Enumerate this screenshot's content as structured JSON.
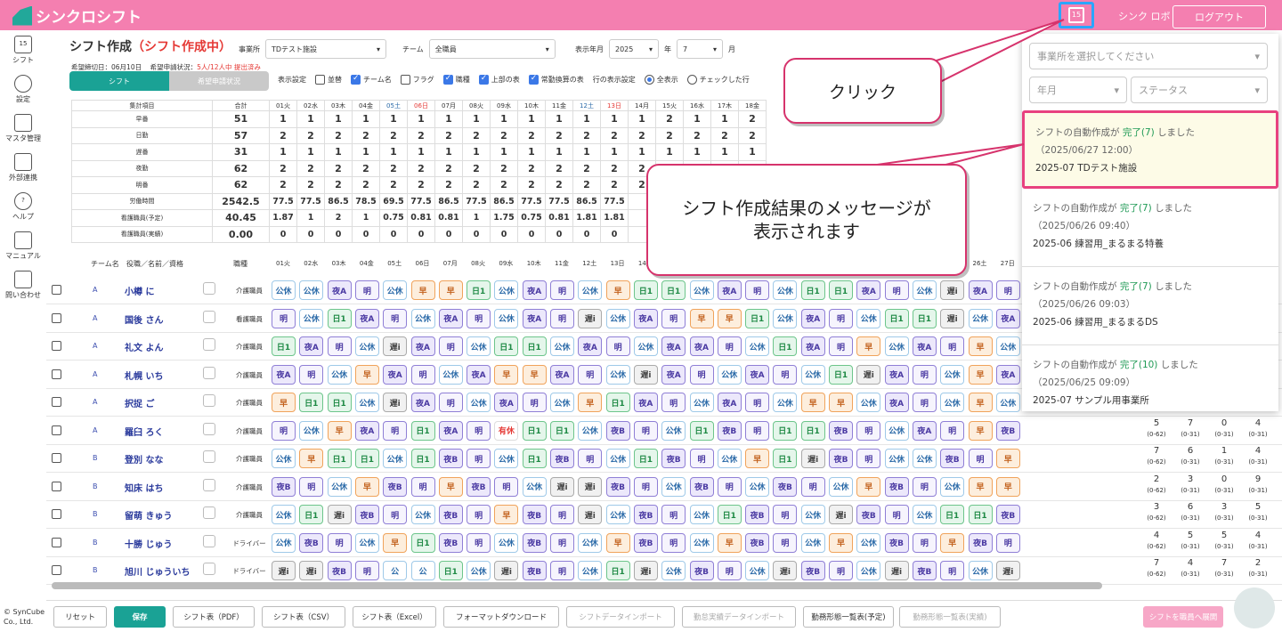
{
  "app": {
    "logo": "シンクロシフト",
    "sync_user": "シンク ロボ",
    "logout": "ログアウト",
    "calendar_day": "15"
  },
  "sidebar": [
    {
      "label": "シフト",
      "icon": "calendar-icon"
    },
    {
      "label": "設定",
      "icon": "gear-icon"
    },
    {
      "label": "マスタ管理",
      "icon": "database-icon"
    },
    {
      "label": "外部連携",
      "icon": "cloud-icon"
    },
    {
      "label": "ヘルプ",
      "icon": "help-icon"
    },
    {
      "label": "マニュアル",
      "icon": "manual-icon"
    },
    {
      "label": "問い合わせ",
      "icon": "mail-icon"
    }
  ],
  "copyright": "© SynCube Co., Ltd.",
  "header": {
    "title": "シフト作成",
    "status": "（シフト作成中）",
    "office_label": "事業所",
    "office": "TDテスト施設",
    "team_label": "チーム",
    "team": "全職員",
    "ym_label": "表示年月",
    "year": "2025",
    "year_unit": "年",
    "month": "7",
    "month_unit": "月",
    "deadline": "希望締切日：06月10日",
    "request_label": "希望申請状況：",
    "request_status": "5人/12人中 提出済み"
  },
  "tabs": {
    "shift": "シフト",
    "request": "希望申請状況"
  },
  "options": {
    "label": "表示設定",
    "items": [
      {
        "t": "並替",
        "on": false
      },
      {
        "t": "チーム名",
        "on": true
      },
      {
        "t": "フラグ",
        "on": false
      },
      {
        "t": "職種",
        "on": true
      },
      {
        "t": "上部の表",
        "on": true
      },
      {
        "t": "常勤換算の表",
        "on": true
      }
    ],
    "row_label": "行の表示設定",
    "all": "全表示",
    "checked": "チェックした行"
  },
  "summary": {
    "head": "集計項目",
    "total": "合計",
    "days": [
      "01火",
      "02水",
      "03木",
      "04金",
      "05土",
      "06日",
      "07月",
      "08火",
      "09水",
      "10木",
      "11金",
      "12土",
      "13日",
      "14月",
      "15火",
      "16水",
      "17木",
      "18金"
    ],
    "rows": [
      {
        "l": "早番",
        "t": "51",
        "v": [
          "1",
          "1",
          "1",
          "1",
          "1",
          "1",
          "1",
          "1",
          "1",
          "1",
          "1",
          "1",
          "1",
          "1",
          "2",
          "1",
          "1",
          "2"
        ]
      },
      {
        "l": "日勤",
        "t": "57",
        "v": [
          "2",
          "2",
          "2",
          "2",
          "2",
          "2",
          "2",
          "2",
          "2",
          "2",
          "2",
          "2",
          "2",
          "2",
          "2",
          "2",
          "2",
          "2"
        ]
      },
      {
        "l": "遅番",
        "t": "31",
        "v": [
          "1",
          "1",
          "1",
          "1",
          "1",
          "1",
          "1",
          "1",
          "1",
          "1",
          "1",
          "1",
          "1",
          "1",
          "1",
          "1",
          "1",
          "1"
        ]
      },
      {
        "l": "夜勤",
        "t": "62",
        "v": [
          "2",
          "2",
          "2",
          "2",
          "2",
          "2",
          "2",
          "2",
          "2",
          "2",
          "2",
          "2",
          "2",
          "2",
          "2",
          "2",
          "2",
          "2"
        ]
      },
      {
        "l": "明番",
        "t": "62",
        "v": [
          "2",
          "2",
          "2",
          "2",
          "2",
          "2",
          "2",
          "2",
          "2",
          "2",
          "2",
          "2",
          "2",
          "2",
          "2",
          "2",
          "2",
          "2"
        ]
      },
      {
        "l": "労働時間",
        "t": "2542.5",
        "v": [
          "77.5",
          "77.5",
          "86.5",
          "78.5",
          "69.5",
          "77.5",
          "86.5",
          "77.5",
          "86.5",
          "77.5",
          "77.5",
          "86.5",
          "77.5",
          "",
          "",
          "",
          "",
          ""
        ]
      },
      {
        "l": "看護職員(予定)",
        "t": "40.45",
        "v": [
          "1.87",
          "1",
          "2",
          "1",
          "0.75",
          "0.81",
          "0.81",
          "1",
          "1.75",
          "0.75",
          "0.81",
          "1.81",
          "1.81",
          "",
          "",
          "",
          "",
          ""
        ]
      },
      {
        "l": "看護職員(実績)",
        "t": "0.00",
        "v": [
          "0",
          "0",
          "0",
          "0",
          "0",
          "0",
          "0",
          "0",
          "0",
          "0",
          "0",
          "0",
          "0",
          "",
          "",
          "",
          "",
          ""
        ]
      }
    ]
  },
  "roster_head": {
    "team": "チーム名",
    "role": "役職／名前／資格",
    "job": "職種"
  },
  "staff": [
    {
      "team": "A",
      "name": "小樽 に",
      "job": "介護職員",
      "s": [
        "公休",
        "公休",
        "夜A",
        "明",
        "公休",
        "早",
        "早",
        "日1",
        "公休",
        "夜A",
        "明",
        "公休",
        "早",
        "日1",
        "日1",
        "公休",
        "夜A",
        "明",
        "公休",
        "日1",
        "日1",
        "夜A",
        "明",
        "公休",
        "遅i",
        "夜A",
        "明"
      ]
    },
    {
      "team": "A",
      "name": "国後 さん",
      "job": "看護職員",
      "s": [
        "明",
        "公休",
        "日1",
        "夜A",
        "明",
        "公休",
        "夜A",
        "明",
        "公休",
        "夜A",
        "明",
        "遅i",
        "公休",
        "夜A",
        "明",
        "早",
        "早",
        "日1",
        "公休",
        "夜A",
        "明",
        "公休",
        "日1",
        "日1",
        "遅i",
        "公休",
        "夜A"
      ]
    },
    {
      "team": "A",
      "name": "礼文 よん",
      "job": "介護職員",
      "s": [
        "日1",
        "夜A",
        "明",
        "公休",
        "遅i",
        "夜A",
        "明",
        "公休",
        "日1",
        "日1",
        "公休",
        "夜A",
        "明",
        "公休",
        "夜A",
        "夜A",
        "明",
        "公休",
        "日1",
        "夜A",
        "明",
        "早",
        "公休",
        "夜A",
        "明",
        "早",
        "公休"
      ]
    },
    {
      "team": "A",
      "name": "札幌 いち",
      "job": "介護職員",
      "s": [
        "夜A",
        "明",
        "公休",
        "早",
        "夜A",
        "明",
        "公休",
        "夜A",
        "早",
        "早",
        "夜A",
        "明",
        "公休",
        "遅i",
        "夜A",
        "明",
        "公休",
        "夜A",
        "明",
        "公休",
        "日1",
        "遅i",
        "夜A",
        "明",
        "公休",
        "早",
        "夜A"
      ]
    },
    {
      "team": "A",
      "name": "択捉 ご",
      "job": "介護職員",
      "s": [
        "早",
        "日1",
        "日1",
        "公休",
        "遅i",
        "夜A",
        "明",
        "公休",
        "夜A",
        "明",
        "公休",
        "早",
        "日1",
        "夜A",
        "明",
        "公休",
        "夜A",
        "明",
        "公休",
        "早",
        "早",
        "公休",
        "夜A",
        "明",
        "公休",
        "早",
        "公休"
      ]
    },
    {
      "team": "A",
      "name": "羅臼 ろく",
      "job": "介護職員",
      "s": [
        "明",
        "公休",
        "早",
        "夜A",
        "明",
        "日1",
        "夜A",
        "明",
        "有休",
        "日1",
        "日1",
        "公休",
        "夜B",
        "明",
        "公休",
        "日1",
        "夜B",
        "明",
        "日1",
        "日1",
        "夜B",
        "明",
        "公休",
        "夜A",
        "明",
        "早",
        "夜B"
      ]
    },
    {
      "team": "B",
      "name": "登別 なな",
      "job": "介護職員",
      "s": [
        "公休",
        "早",
        "日1",
        "日1",
        "公休",
        "日1",
        "夜B",
        "明",
        "公休",
        "日1",
        "夜B",
        "明",
        "公休",
        "日1",
        "夜B",
        "明",
        "公休",
        "早",
        "日1",
        "遅i",
        "夜B",
        "明",
        "公休",
        "公休",
        "夜B",
        "明",
        "早"
      ]
    },
    {
      "team": "B",
      "name": "知床 はち",
      "job": "介護職員",
      "s": [
        "夜B",
        "明",
        "公休",
        "早",
        "夜B",
        "明",
        "早",
        "夜B",
        "明",
        "公休",
        "遅i",
        "遅i",
        "夜B",
        "明",
        "公休",
        "夜B",
        "明",
        "公休",
        "夜B",
        "明",
        "公休",
        "早",
        "夜B",
        "明",
        "公休",
        "早",
        "早"
      ]
    },
    {
      "team": "B",
      "name": "留萌 きゅう",
      "job": "介護職員",
      "s": [
        "公休",
        "日1",
        "遅i",
        "夜B",
        "明",
        "公休",
        "夜B",
        "明",
        "早",
        "夜B",
        "明",
        "遅i",
        "公休",
        "夜B",
        "明",
        "公休",
        "日1",
        "夜B",
        "明",
        "公休",
        "遅i",
        "夜B",
        "明",
        "公休",
        "日1",
        "日1",
        "夜B"
      ]
    },
    {
      "team": "B",
      "name": "十勝 じゅう",
      "job": "ドライバー",
      "s": [
        "公休",
        "夜B",
        "明",
        "公休",
        "早",
        "日1",
        "夜B",
        "明",
        "公休",
        "夜B",
        "明",
        "公休",
        "早",
        "夜B",
        "明",
        "公休",
        "早",
        "夜B",
        "明",
        "公休",
        "早",
        "公休",
        "夜B",
        "明",
        "早",
        "夜B",
        "明"
      ]
    },
    {
      "team": "B",
      "name": "旭川 じゅういち",
      "job": "ドライバー",
      "s": [
        "遅i",
        "遅i",
        "夜B",
        "明",
        "公",
        "公",
        "日1",
        "公休",
        "遅i",
        "夜B",
        "明",
        "公休",
        "日1",
        "遅i",
        "公休",
        "夜B",
        "明",
        "公休",
        "遅i",
        "夜B",
        "明",
        "公休",
        "遅i",
        "夜B",
        "明",
        "公休",
        "遅i"
      ]
    }
  ],
  "right_stats": [
    [
      "5",
      "7",
      "0",
      "4"
    ],
    [
      "7",
      "6",
      "1",
      "4"
    ],
    [
      "2",
      "3",
      "0",
      "9"
    ],
    [
      "3",
      "6",
      "3",
      "5"
    ],
    [
      "4",
      "5",
      "5",
      "4"
    ],
    [
      "7",
      "4",
      "7",
      "2"
    ]
  ],
  "right_ranges": [
    "(0-62)",
    "(0-31)",
    "(0-31)",
    "(0-31)"
  ],
  "panel": {
    "office_ph": "事業所を選択してください",
    "ym_ph": "年月",
    "status_ph": "ステータス",
    "messages": [
      {
        "head": "シフトの自動作成が",
        "ok": "完了(7)",
        "tail": "しました",
        "time": "（2025/06/27 12:00）",
        "site": "2025-07 TDテスト施設"
      },
      {
        "head": "シフトの自動作成が",
        "ok": "完了(7)",
        "tail": "しました",
        "time": "（2025/06/26 09:40）",
        "site": "2025-06 練習用_まるまる特養"
      },
      {
        "head": "シフトの自動作成が",
        "ok": "完了(7)",
        "tail": "しました",
        "time": "（2025/06/26 09:03）",
        "site": "2025-06 練習用_まるまるDS"
      },
      {
        "head": "シフトの自動作成が",
        "ok": "完了(10)",
        "tail": "しました",
        "time": "（2025/06/25 09:09）",
        "site": "2025-07 サンプル用事業所"
      }
    ]
  },
  "callouts": {
    "click": "クリック",
    "message": "シフト作成結果のメッセージが表示されます"
  },
  "footer": [
    "リセット",
    "保存",
    "シフト表（PDF）",
    "シフト表（CSV）",
    "シフト表（Excel）",
    "フォーマットダウンロード",
    "シフトデータインポート",
    "勤怠実績データインポート",
    "勤務形態一覧表(予定)",
    "勤務形態一覧表(実績)",
    "シフトを職員へ展開"
  ]
}
